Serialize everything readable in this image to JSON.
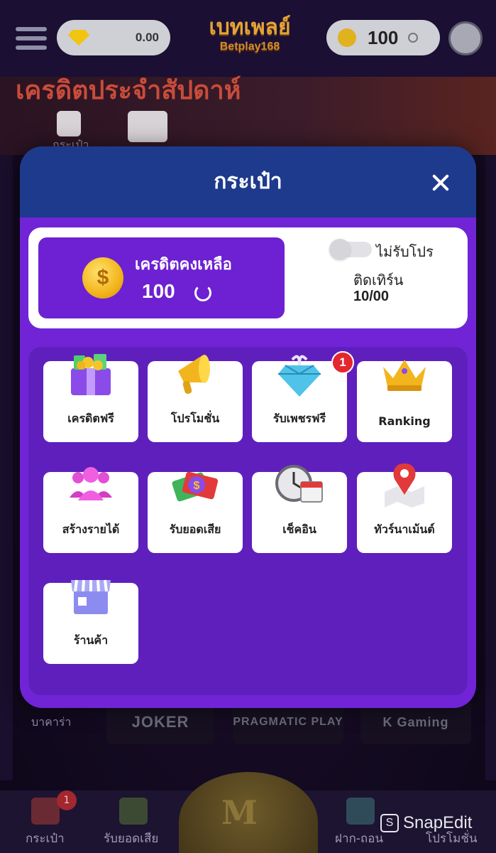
{
  "header": {
    "diamond_balance": "0.00",
    "coin_balance": "100",
    "logo_text": "เบทเพลย์",
    "logo_sub": "Betplay168"
  },
  "background": {
    "banner_text": "เครดิตประจำสัปดาห์",
    "wallet_caption": "กระเป๋า",
    "baccarat_label": "บาคาร่า",
    "providers": [
      "JOKER",
      "PRAGMATIC PLAY",
      "K Gaming"
    ],
    "bottom_nav": [
      {
        "label": "กระเป๋า",
        "badge": "1"
      },
      {
        "label": "รับยอดเสีย"
      },
      {
        "label": "ฝาก-ถอน"
      },
      {
        "label": "โปรโมชั่น"
      }
    ],
    "watermark": "SnapEdit"
  },
  "modal": {
    "title": "กระเป๋า",
    "balance_label": "เครดิตคงเหลือ",
    "balance_value": "100",
    "no_promo_label": "ไม่รับโปร",
    "no_promo_enabled": false,
    "turnover_label": "ติดเทิร์น",
    "turnover_value": "10/00",
    "menu": [
      {
        "label": "เครดิตฟรี",
        "icon": "gift-box-icon"
      },
      {
        "label": "โปรโมชั่น",
        "icon": "megaphone-icon"
      },
      {
        "label": "รับเพชรฟรี",
        "icon": "diamond-gift-icon",
        "badge": "1"
      },
      {
        "label": "Ranking",
        "icon": "crown-icon"
      },
      {
        "label": "สร้างรายได้",
        "icon": "users-icon"
      },
      {
        "label": "รับยอดเสีย",
        "icon": "money-icon"
      },
      {
        "label": "เช็คอิน",
        "icon": "clock-calendar-icon"
      },
      {
        "label": "ทัวร์นาเม้นต์",
        "icon": "map-pin-icon"
      },
      {
        "label": "ร้านค้า",
        "icon": "store-icon"
      }
    ]
  },
  "colors": {
    "modal_bg": "#7124d6",
    "modal_header": "#1e3a8c",
    "grid_panel": "#5f1fbd",
    "badge": "#e3262f",
    "coin": "#f2b51c"
  }
}
